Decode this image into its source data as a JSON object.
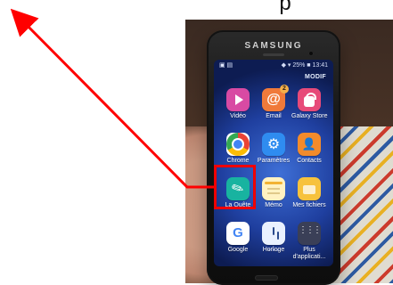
{
  "top_glyph": "p",
  "device": {
    "brand": "SAMSUNG",
    "screen": {
      "status_left": "▣ ▤",
      "status_right": "◆ ▾ 25% ■ 13:41",
      "modif_label": "MODIF",
      "apps": [
        {
          "name": "Vidéo",
          "icon": "video-play-icon",
          "highlighted": false
        },
        {
          "name": "Email",
          "icon": "email-icon",
          "highlighted": false,
          "badge": "2"
        },
        {
          "name": "Galaxy Store",
          "icon": "galaxy-store-icon",
          "highlighted": false
        },
        {
          "name": "Chrome",
          "icon": "chrome-icon",
          "highlighted": false
        },
        {
          "name": "Paramètres",
          "icon": "settings-gear-icon",
          "highlighted": false
        },
        {
          "name": "Contacts",
          "icon": "contacts-icon",
          "highlighted": false
        },
        {
          "name": "La Quête",
          "icon": "la-quete-icon",
          "highlighted": true
        },
        {
          "name": "Mémo",
          "icon": "memo-icon",
          "highlighted": false
        },
        {
          "name": "Mes fichiers",
          "icon": "files-folder-icon",
          "highlighted": false
        },
        {
          "name": "Google",
          "icon": "google-icon",
          "highlighted": false
        },
        {
          "name": "Horloge",
          "icon": "clock-icon",
          "highlighted": false
        },
        {
          "name": "Plus d'applicati...",
          "icon": "more-apps-icon",
          "highlighted": false
        }
      ],
      "page_dots": "• • •"
    }
  },
  "annotation": {
    "arrow_color": "#ff0000",
    "box_color": "#f00000"
  }
}
